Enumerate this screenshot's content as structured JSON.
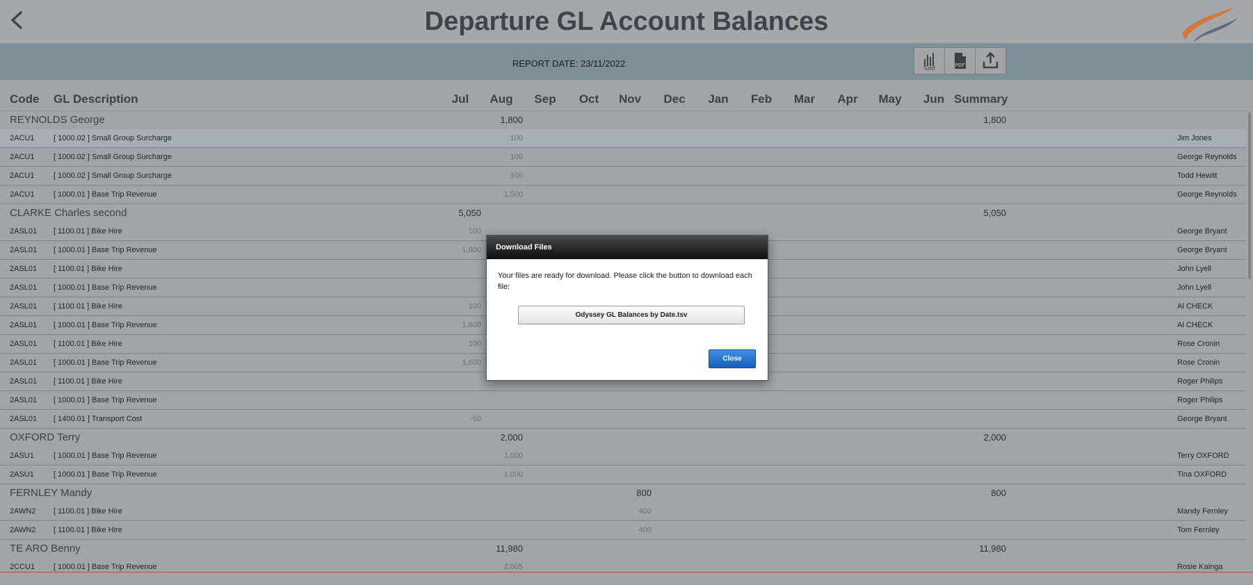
{
  "header": {
    "title": "Departure GL Account Balances"
  },
  "toolbar": {
    "report_date": "REPORT DATE: 23/11/2022",
    "sort_label": "Sort",
    "pdf_label": "PDF"
  },
  "columns": {
    "code": "Code",
    "desc": "GL Description",
    "months": [
      "Jul",
      "Aug",
      "Sep",
      "Oct",
      "Nov",
      "Dec",
      "Jan",
      "Feb",
      "Mar",
      "Apr",
      "May",
      "Jun"
    ],
    "summary": "Summary"
  },
  "groups": [
    {
      "name": "REYNOLDS George",
      "values": {
        "Aug": "1,800",
        "Summary": "1,800"
      },
      "rows": [
        {
          "code": "2ACU1",
          "desc": "[ 1000.02 ]  Small Group Surcharge",
          "values": {
            "Aug": "100"
          },
          "person": "Jim Jones"
        },
        {
          "code": "2ACU1",
          "desc": "[ 1000.02 ]  Small Group Surcharge",
          "values": {
            "Aug": "100"
          },
          "person": "George Reynolds"
        },
        {
          "code": "2ACU1",
          "desc": "[ 1000.02 ]  Small Group Surcharge",
          "values": {
            "Aug": "100"
          },
          "person": "Todd Hewitt"
        },
        {
          "code": "2ACU1",
          "desc": "[ 1000.01 ]  Base Trip Revenue",
          "values": {
            "Aug": "1,500"
          },
          "person": "George Reynolds"
        }
      ]
    },
    {
      "name": "CLARKE Charles second",
      "values": {
        "Jul": "5,050",
        "Summary": "5,050"
      },
      "rows": [
        {
          "code": "2ASL01",
          "desc": "[ 1100.01 ]  Bike Hire",
          "values": {
            "Jul": "100"
          },
          "person": "George Bryant"
        },
        {
          "code": "2ASL01",
          "desc": "[ 1000.01 ]  Base Trip Revenue",
          "values": {
            "Jul": "1,600"
          },
          "person": "George Bryant"
        },
        {
          "code": "2ASL01",
          "desc": "[ 1100.01 ]  Bike Hire",
          "values": {},
          "person": "John Lyell"
        },
        {
          "code": "2ASL01",
          "desc": "[ 1000.01 ]  Base Trip Revenue",
          "values": {},
          "person": "John Lyell"
        },
        {
          "code": "2ASL01",
          "desc": "[ 1100.01 ]  Bike Hire",
          "values": {
            "Jul": "100"
          },
          "person": "Al CHECK"
        },
        {
          "code": "2ASL01",
          "desc": "[ 1000.01 ]  Base Trip Revenue",
          "values": {
            "Jul": "1,600"
          },
          "person": "Al CHECK"
        },
        {
          "code": "2ASL01",
          "desc": "[ 1100.01 ]  Bike Hire",
          "values": {
            "Jul": "100"
          },
          "person": "Rose Cronin"
        },
        {
          "code": "2ASL01",
          "desc": "[ 1000.01 ]  Base Trip Revenue",
          "values": {
            "Jul": "1,600"
          },
          "person": "Rose Cronin"
        },
        {
          "code": "2ASL01",
          "desc": "[ 1100.01 ]  Bike Hire",
          "values": {},
          "person": "Roger Philips"
        },
        {
          "code": "2ASL01",
          "desc": "[ 1000.01 ]  Base Trip Revenue",
          "values": {},
          "person": "Roger Philips"
        },
        {
          "code": "2ASL01",
          "desc": "[ 1400.01 ]  Transport Cost",
          "values": {
            "Jul": "-50"
          },
          "person": "George Bryant"
        }
      ]
    },
    {
      "name": "OXFORD Terry",
      "values": {
        "Aug": "2,000",
        "Summary": "2,000"
      },
      "rows": [
        {
          "code": "2ASU1",
          "desc": "[ 1000.01 ]  Base Trip Revenue",
          "values": {
            "Aug": "1,000"
          },
          "person": "Terry OXFORD"
        },
        {
          "code": "2ASU1",
          "desc": "[ 1000.01 ]  Base Trip Revenue",
          "values": {
            "Aug": "1,000"
          },
          "person": "Tina OXFORD"
        }
      ]
    },
    {
      "name": "FERNLEY Mandy",
      "values": {
        "Nov": "800",
        "Summary": "800"
      },
      "rows": [
        {
          "code": "2AWN2",
          "desc": "[ 1100.01 ]  Bike Hire",
          "values": {
            "Nov": "400"
          },
          "person": "Mandy Fernley"
        },
        {
          "code": "2AWN2",
          "desc": "[ 1100.01 ]  Bike Hire",
          "values": {
            "Nov": "400"
          },
          "person": "Tom Fernley"
        }
      ]
    },
    {
      "name": "TE ARO Benny",
      "values": {
        "Aug": "11,980",
        "Summary": "11,980"
      },
      "rows": [
        {
          "code": "2CCU1",
          "desc": "[ 1000.01 ]  Base Trip Revenue",
          "values": {
            "Aug": "2,005"
          },
          "person": "Rosie Kainga"
        }
      ]
    }
  ],
  "dialog": {
    "title": "Download Files",
    "message": "Your files are ready for download. Please click the button to download each file:",
    "file_button": "Odyssey GL Balances by Date.tsv",
    "close_button": "Close"
  }
}
